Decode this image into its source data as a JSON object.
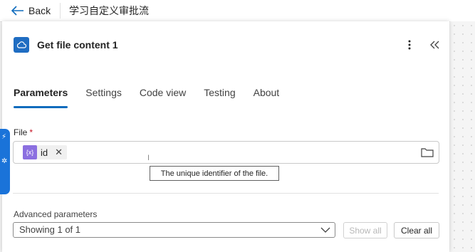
{
  "topbar": {
    "back_label": "Back",
    "flow_title": "学习自定义审批流"
  },
  "panel": {
    "title": "Get file content 1",
    "icon": "onedrive-cloud-icon",
    "tabs": [
      {
        "label": "Parameters",
        "active": true
      },
      {
        "label": "Settings",
        "active": false
      },
      {
        "label": "Code view",
        "active": false
      },
      {
        "label": "Testing",
        "active": false
      },
      {
        "label": "About",
        "active": false
      }
    ]
  },
  "file_field": {
    "label": "File",
    "required_mark": "*",
    "token_text": "id",
    "token_icon": "{x}",
    "tooltip": "The unique identifier of the file."
  },
  "advanced": {
    "label": "Advanced parameters",
    "select_value": "Showing 1 of 1",
    "show_all_label": "Show all",
    "clear_all_label": "Clear all"
  },
  "colors": {
    "accent": "#0f6cbd",
    "connector": "#1f6dc2",
    "token": "#8b6fe0",
    "required": "#c50f1f"
  }
}
